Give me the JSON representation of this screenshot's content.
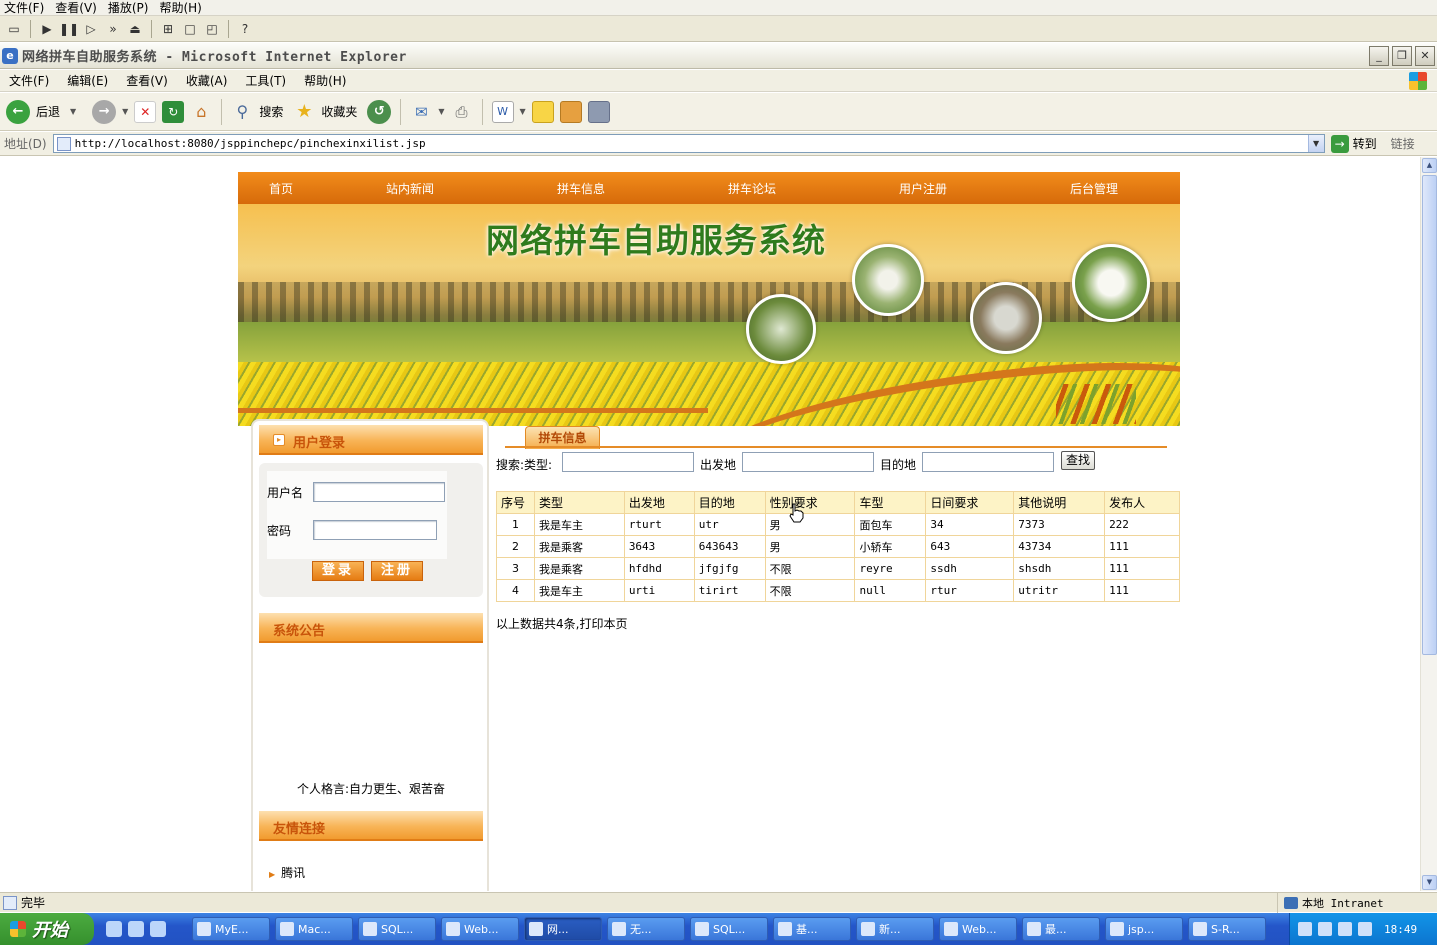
{
  "player": {
    "menu": [
      "文件(F)",
      "查看(V)",
      "播放(P)",
      "帮助(H)"
    ],
    "toolbar_icons": [
      "open-icon",
      "play-icon",
      "pause-icon",
      "step-icon",
      "fast-forward-icon",
      "eject-icon",
      "fullscreen-icon",
      "window-icon",
      "resize-icon",
      "help-icon"
    ]
  },
  "window": {
    "title": "网络拼车自助服务系统 - Microsoft Internet Explorer",
    "controls": [
      "minimize",
      "maximize",
      "close"
    ]
  },
  "ie_menu": [
    "文件(F)",
    "编辑(E)",
    "查看(V)",
    "收藏(A)",
    "工具(T)",
    "帮助(H)"
  ],
  "ie_toolbar": {
    "back_label": "后退",
    "search_label": "搜索",
    "favorites_label": "收藏夹"
  },
  "addressbar": {
    "label": "地址(D)",
    "url": "http://localhost:8080/jsppinchepc/pinchexinxilist.jsp",
    "go_label": "转到",
    "links_label": "链接"
  },
  "site": {
    "nav": [
      "首页",
      "站内新闻",
      "拼车信息",
      "拼车论坛",
      "用户注册",
      "后台管理"
    ],
    "banner_title": "网络拼车自助服务系统",
    "login": {
      "title": "用户登录",
      "username_label": "用户名",
      "password_label": "密码",
      "login_button": "登录",
      "register_button": "注册"
    },
    "announcement": {
      "title": "系统公告",
      "text": "个人格言:自力更生、艰苦奋"
    },
    "links": {
      "title": "友情连接",
      "items": [
        "腾讯"
      ]
    }
  },
  "listing": {
    "tab": "拼车信息",
    "search": {
      "prefix": "搜索:类型:",
      "from_label": "出发地",
      "to_label": "目的地",
      "button": "查找"
    },
    "columns": [
      "序号",
      "类型",
      "出发地",
      "目的地",
      "性别要求",
      "车型",
      "日间要求",
      "其他说明",
      "发布人"
    ],
    "rows": [
      [
        "1",
        "我是车主",
        "rturt",
        "utr",
        "男",
        "面包车",
        "34",
        "7373",
        "222"
      ],
      [
        "2",
        "我是乘客",
        "3643",
        "643643",
        "男",
        "小轿车",
        "643",
        "43734",
        "111"
      ],
      [
        "3",
        "我是乘客",
        "hfdhd",
        "jfgjfg",
        "不限",
        "reyre",
        "ssdh",
        "shsdh",
        "111"
      ],
      [
        "4",
        "我是车主",
        "urti",
        "tirirt",
        "不限",
        "null",
        "rtur",
        "utritr",
        "111"
      ]
    ],
    "summary": "以上数据共4条,打印本页"
  },
  "status": {
    "text": "完毕",
    "zone": "本地 Intranet"
  },
  "taskbar": {
    "start": "开始",
    "tasks": [
      "MyE...",
      "Mac...",
      "SQL...",
      "Web...",
      "网...",
      "无...",
      "SQL...",
      "基...",
      "新...",
      "Web...",
      "最...",
      "jsp...",
      "S-R..."
    ],
    "active_task": 4,
    "clock": "18:49"
  }
}
